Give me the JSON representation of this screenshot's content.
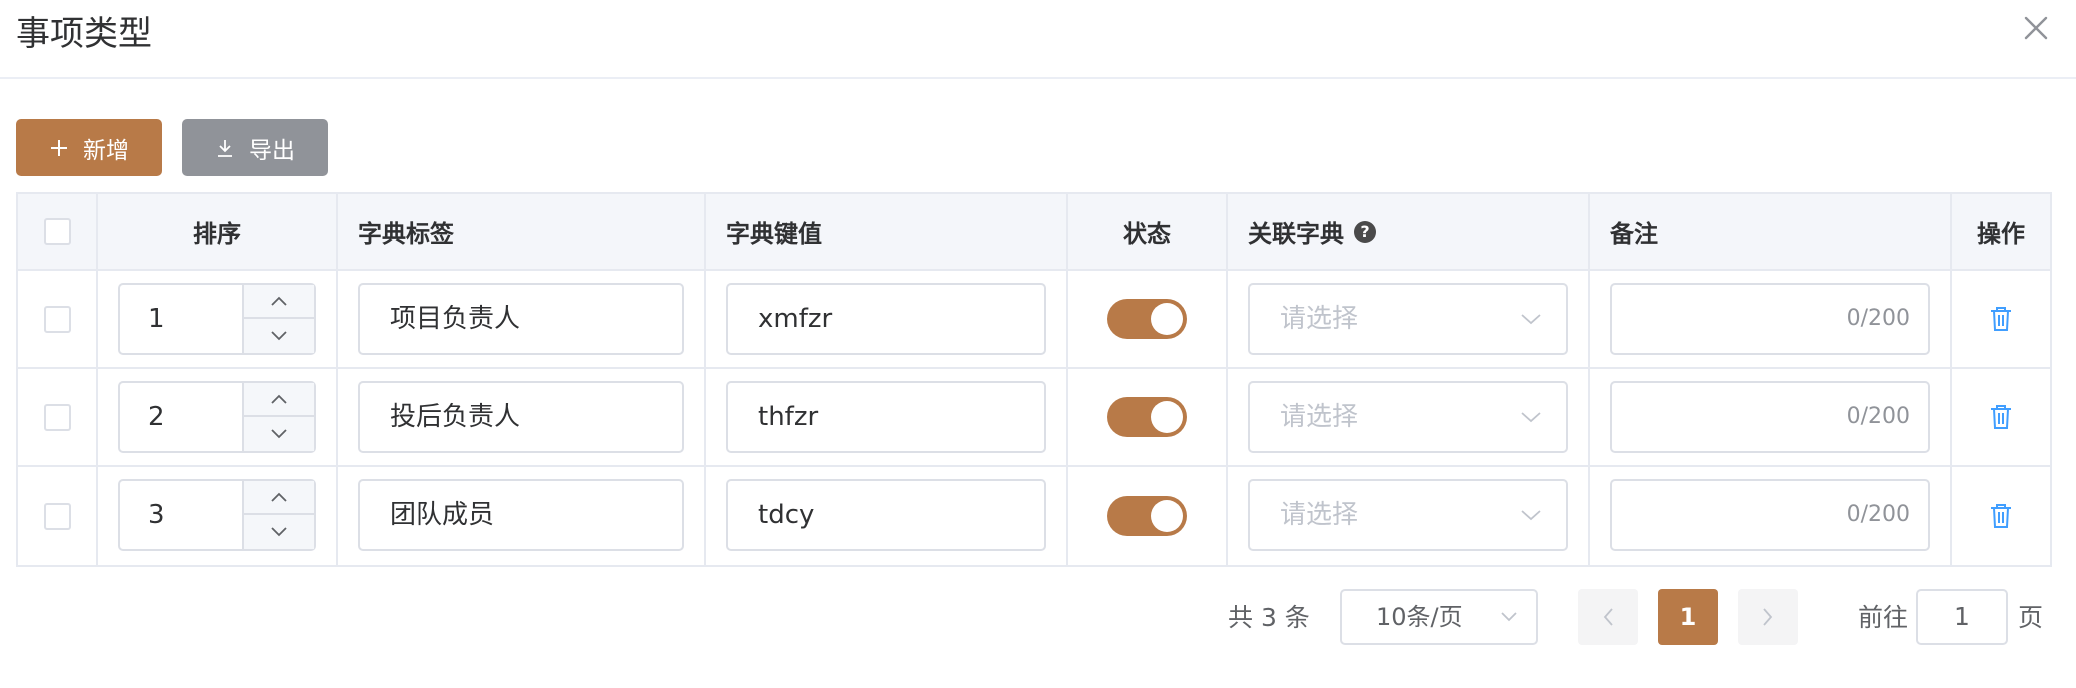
{
  "dialog": {
    "title": "事项类型"
  },
  "toolbar": {
    "add_label": "新增",
    "export_label": "导出"
  },
  "table": {
    "headers": {
      "sort": "排序",
      "label": "字典标签",
      "key": "字典键值",
      "status": "状态",
      "dict": "关联字典",
      "remark": "备注",
      "op": "操作"
    },
    "rows": [
      {
        "sort": "1",
        "label": "项目负责人",
        "key": "xmfzr",
        "status": true,
        "dict_placeholder": "请选择",
        "remark_count": "0/200"
      },
      {
        "sort": "2",
        "label": "投后负责人",
        "key": "thfzr",
        "status": true,
        "dict_placeholder": "请选择",
        "remark_count": "0/200"
      },
      {
        "sort": "3",
        "label": "团队成员",
        "key": "tdcy",
        "status": true,
        "dict_placeholder": "请选择",
        "remark_count": "0/200"
      }
    ]
  },
  "pagination": {
    "total_text": "共 3 条",
    "page_size": "10条/页",
    "current_page": "1",
    "goto_label": "前往",
    "goto_value": "1",
    "page_unit": "页"
  },
  "colors": {
    "accent": "#b87a48",
    "export": "#909399",
    "icon_blue": "#409eff"
  }
}
